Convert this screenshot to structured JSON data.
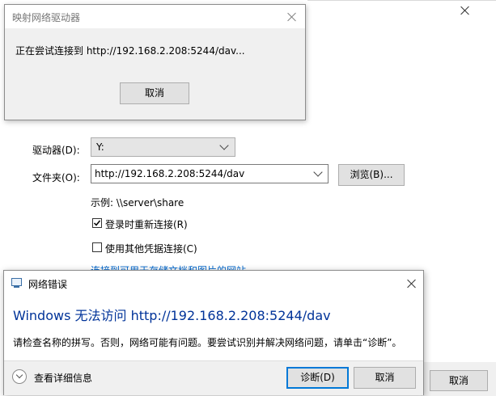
{
  "map_wizard": {
    "drive_label": "驱动器(D):",
    "drive_value": "Y:",
    "folder_label": "文件夹(O):",
    "folder_value": "http://192.168.2.208:5244/dav",
    "browse_label": "浏览(B)...",
    "example_text": "示例: \\\\server\\share",
    "reconnect_label": "登录时重新连接(R)",
    "reconnect_checked": true,
    "other_creds_label": "使用其他凭据连接(C)",
    "other_creds_checked": false,
    "link_text": "连接到可用于存储文档和图片的网站。",
    "cancel_label": "取消"
  },
  "connecting_dialog": {
    "title": "映射网络驱动器",
    "message": "正在尝试连接到 http://192.168.2.208:5244/dav...",
    "cancel_label": "取消"
  },
  "error_dialog": {
    "title": "网络错误",
    "heading": "Windows 无法访问 http://192.168.2.208:5244/dav",
    "body": "请检查名称的拼写。否则，网络可能有问题。要尝试识别并解决网络问题，请单击“诊断”。",
    "details_label": "查看详细信息",
    "diagnose_label": "诊断(D)",
    "cancel_label": "取消",
    "heading_color": "#003399"
  }
}
